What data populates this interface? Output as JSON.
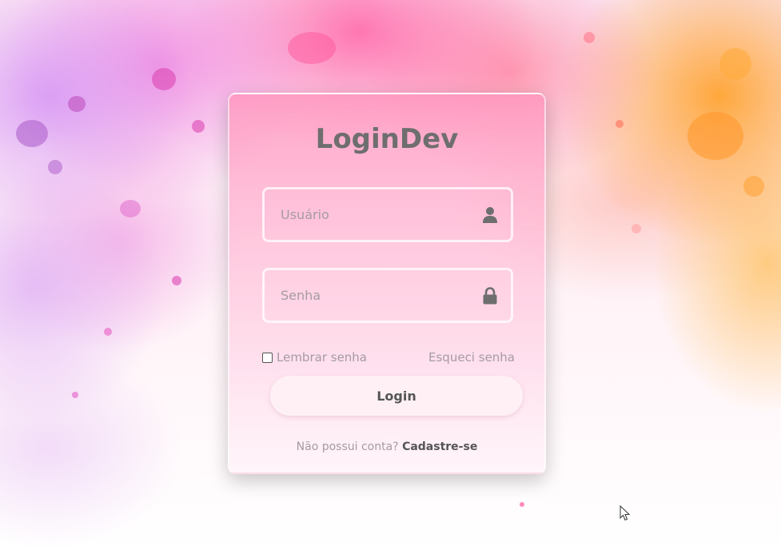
{
  "app": {
    "title": "LoginDev"
  },
  "form": {
    "username": {
      "placeholder": "Usuário",
      "value": "",
      "icon": "user-icon"
    },
    "password": {
      "placeholder": "Senha",
      "value": "",
      "icon": "lock-icon"
    },
    "remember_label": "Lembrar senha",
    "remember_checked": false,
    "forgot_label": "Esqueci senha",
    "login_label": "Login",
    "signup_prompt": "Não possui conta?",
    "signup_link": "Cadastre-se"
  },
  "colors": {
    "title": "#6e6e6e",
    "muted_text": "#a69ba2",
    "dark_text": "#555555",
    "card_top": "#ff96be",
    "accent_pink": "#ff5aa0",
    "accent_orange": "#ffa028",
    "accent_purple": "#d696f5"
  }
}
